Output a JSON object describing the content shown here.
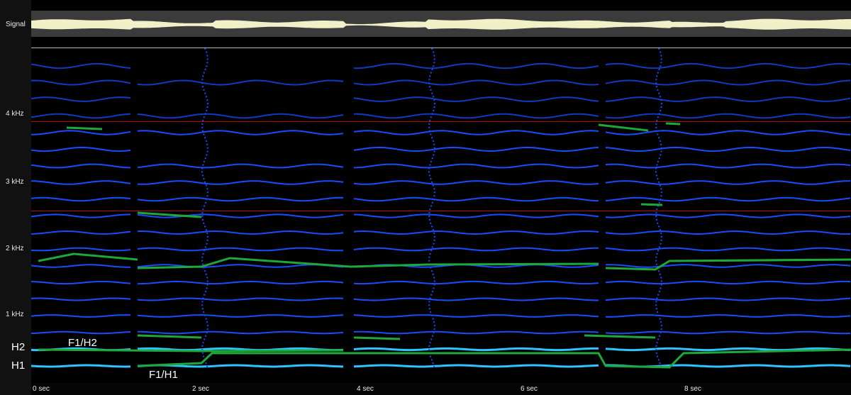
{
  "panel": {
    "signal_label": "Signal"
  },
  "freq_labels": [
    "4 kHz",
    "3 kHz",
    "2 kHz",
    "1 kHz"
  ],
  "harmonic_labels": {
    "h2": "H2",
    "h1": "H1",
    "f1h2": "F1/H2",
    "f1h1": "F1/H1"
  },
  "time_labels": [
    "0  sec",
    "2  sec",
    "4  sec",
    "6  sec",
    "8  sec"
  ],
  "colors": {
    "background": "#000000",
    "harmonic_track": "#1a4cff",
    "harmonic_bright": "#2ec4ff",
    "formant_track": "#1fa83a",
    "red_line": "#b01010",
    "signal_wave": "#f2f0c8",
    "signal_bg": "#3b3b3b"
  },
  "icons": {
    "spectrogram": "spectrogram-image",
    "waveform": "waveform-image"
  }
}
